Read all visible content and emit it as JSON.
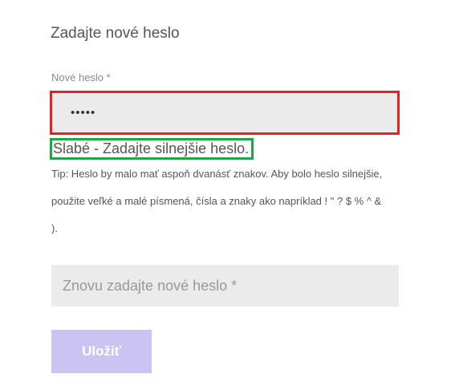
{
  "form": {
    "title": "Zadajte nové heslo",
    "new_password": {
      "label": "Nové heslo *",
      "value": "•••••"
    },
    "strength_message": "Slabé - Zadajte silnejšie heslo.",
    "hint": "Tip: Heslo by malo mať aspoň dvanásť znakov. Aby bolo heslo silnejšie, použite veľké a malé písmená, čísla a znaky ako napríklad ! \" ? $ % ^ & ).",
    "confirm_password": {
      "placeholder": "Znovu zadajte nové heslo *",
      "value": ""
    },
    "save_label": "Uložiť"
  },
  "colors": {
    "error_outline": "#e32228",
    "strength_outline": "#1fa648",
    "input_background": "#ebebeb",
    "button_background": "#cbc4f3"
  }
}
